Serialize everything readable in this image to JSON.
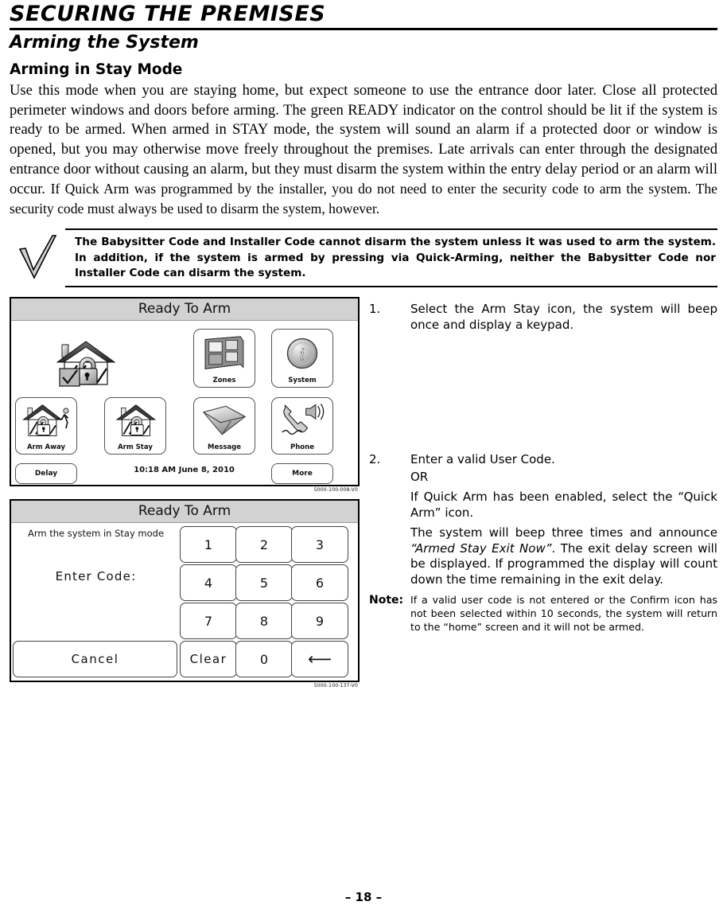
{
  "document": {
    "chapter_title": "SECURING THE PREMISES",
    "section_title": "Arming the System",
    "subsection_title": "Arming in Stay Mode",
    "intro_paragraph_part1": "Use this mode when you are staying home, but expect someone to use the entrance door later.  Close all protected perimeter windows and doors before arming.  The green READY indicator on the control should be lit if the system is ready to be armed. When armed in STAY mode, the system will sound an alarm if a protected door or window is opened, but you may otherwise move freely throughout the premises. Late arrivals can enter through the designated entrance door without causing an alarm, but they must disarm the system within the entry delay period or an alarm will occur.",
    "intro_paragraph_part2": "If Quick Arm was programmed by the installer, you do not need to enter the security code to arm the system.  The security code must always be used to disarm the system, however.",
    "page_number": "– 18 –"
  },
  "callout": {
    "icon": "checkmark-icon",
    "text": "The Babysitter Code and Installer Code cannot disarm the system unless it was used to arm the system. In addition, if the system is armed by pressing via Quick-Arming, neither the Babysitter Code nor Installer Code can disarm the system."
  },
  "home_screen": {
    "title": "Ready To Arm",
    "figure_code": "5000-100-008-V0",
    "status_icon": "house-unlocked-check-icon",
    "tiles": [
      {
        "label": "Zones",
        "icon": "window-grid-icon"
      },
      {
        "label": "System",
        "icon": "info-circle-icon"
      },
      {
        "label": "Arm Away",
        "icon": "house-lock-running-person-icon"
      },
      {
        "label": "Arm Stay",
        "icon": "house-lock-icon"
      },
      {
        "label": "Message",
        "icon": "envelope-icon"
      },
      {
        "label": "Phone",
        "icon": "phone-speaker-icon"
      }
    ],
    "status_bar": {
      "delay_label": "Delay",
      "clock": "10:18 AM  June 8,  2010",
      "more_label": "More"
    }
  },
  "keypad_screen": {
    "title": "Ready To Arm",
    "figure_code": "5000-100-137-V0",
    "prompt_top": "Arm the system in Stay mode",
    "prompt_main": "Enter Code:",
    "keys": [
      "1",
      "2",
      "3",
      "4",
      "5",
      "6",
      "7",
      "8",
      "9"
    ],
    "cancel_label": "Cancel",
    "clear_label": "Clear",
    "zero_label": "0",
    "backspace_icon": "left-arrow-icon"
  },
  "steps": [
    {
      "number": "1.",
      "lines": [
        "Select the Arm Stay icon, the system will beep once and display a keypad."
      ]
    },
    {
      "number": "2.",
      "lines": [
        "Enter a valid User Code.",
        "OR",
        "If Quick Arm has been enabled, select the “Quick Arm” icon."
      ],
      "rich_line_prefix": "The system will beep three times and announce ",
      "rich_line_italic": "“Armed Stay Exit Now”",
      "rich_line_suffix": ". The exit delay screen will be displayed. If programmed the display will count down the time remaining in the exit delay."
    }
  ],
  "note": {
    "label": "Note:",
    "text": "If a valid user code is not entered or the Confirm icon has not been selected within 10 seconds, the system will return to the “home” screen and it will not be armed."
  },
  "colors": {
    "title_bar_bg": "#d2d2d2",
    "tile_border": "#555555",
    "text": "#000000"
  }
}
